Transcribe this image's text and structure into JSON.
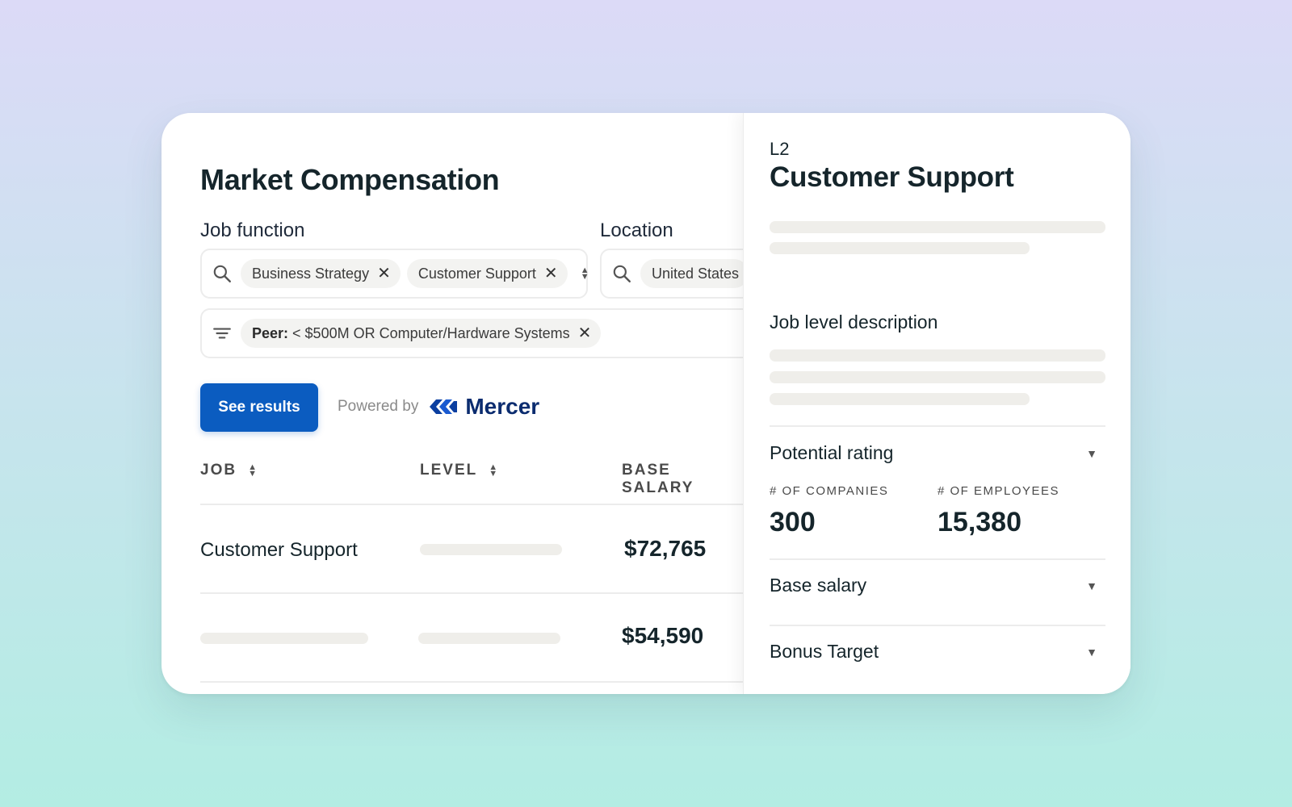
{
  "page_title": "Market Compensation",
  "job_function": {
    "label": "Job function",
    "chips": [
      "Business Strategy",
      "Customer Support"
    ]
  },
  "location": {
    "label": "Location",
    "chips": [
      "United States"
    ]
  },
  "peer_filter": {
    "prefix": "Peer:",
    "value": "< $500M OR Computer/Hardware Systems"
  },
  "see_results_label": "See results",
  "powered_by": "Powered by",
  "brand": "Mercer",
  "table": {
    "headers": {
      "job": "JOB",
      "level": "LEVEL",
      "base_salary": "BASE SALARY"
    },
    "rows": [
      {
        "job": "Customer Support",
        "base_salary": "$72,765"
      },
      {
        "job": "",
        "base_salary": "$54,590"
      }
    ]
  },
  "detail": {
    "level": "L2",
    "title": "Customer Support",
    "job_level_description": "Job level description",
    "potential_rating": {
      "label": "Potential rating",
      "companies_label": "# OF COMPANIES",
      "companies_value": "300",
      "employees_label": "# OF EMPLOYEES",
      "employees_value": "15,380"
    },
    "base_salary_label": "Base salary",
    "bonus_target_label": "Bonus Target"
  },
  "icons": {
    "search": "search-icon",
    "filter": "filter-icon",
    "close": "close-icon",
    "sort": "sort-icon",
    "caret": "chevron-down-icon"
  },
  "colors": {
    "primary": "#0b5cc0",
    "brand": "#0b2c6f",
    "skeleton": "#efeeea"
  }
}
